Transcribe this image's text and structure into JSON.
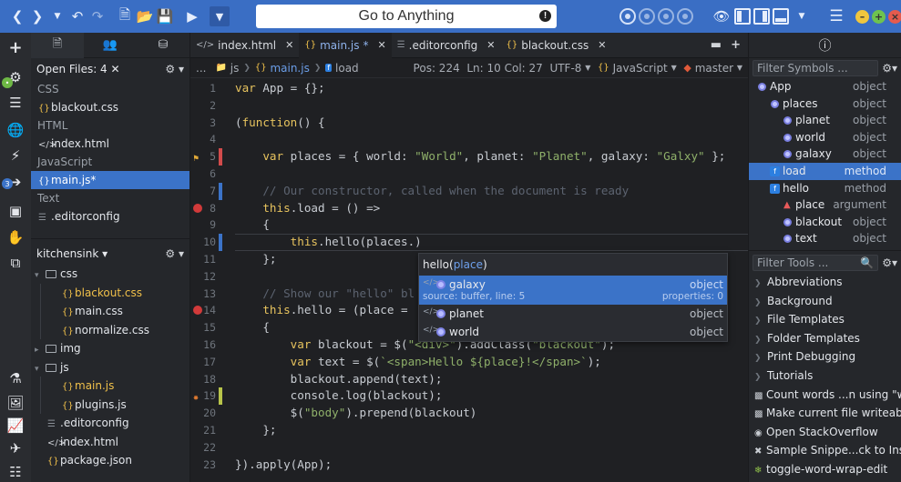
{
  "search": {
    "placeholder": "Go to Anything"
  },
  "left_panel": {
    "open_files_label": "Open Files: 4",
    "groups": [
      {
        "label": "CSS",
        "files": [
          "blackout.css"
        ]
      },
      {
        "label": "HTML",
        "files": [
          "index.html"
        ]
      },
      {
        "label": "JavaScript",
        "files": [
          "main.js*"
        ]
      },
      {
        "label": "Text",
        "files": [
          ".editorconfig"
        ]
      }
    ],
    "project_label": "kitchensink",
    "tree": {
      "css": "css",
      "css_files": [
        "blackout.css",
        "main.css",
        "normalize.css"
      ],
      "img": "img",
      "js": "js",
      "js_files": [
        "main.js",
        "plugins.js"
      ],
      "root_files": [
        ".editorconfig",
        "index.html",
        "package.json"
      ]
    }
  },
  "editor": {
    "tabs": [
      {
        "label": "index.html",
        "dirty": ""
      },
      {
        "label": "main.js",
        "dirty": "*"
      },
      {
        "label": ".editorconfig",
        "dirty": ""
      },
      {
        "label": "blackout.css",
        "dirty": ""
      }
    ],
    "breadcrumb": {
      "ellipsis": "...",
      "folder": "js",
      "file": "main.js",
      "symbol": "load"
    },
    "status": {
      "pos": "Pos: 224",
      "ln": "Ln: 10",
      "col": "Col: 27",
      "encoding": "UTF-8",
      "language": "JavaScript",
      "branch": "master"
    },
    "code_lines": [
      "var App = {};",
      "",
      "(function() {",
      "",
      "    var places = { world: \"World\", planet: \"Planet\", galaxy: \"Galxy\" };",
      "",
      "    // Our constructor, called when the document is ready",
      "    this.load = () =>",
      "    {",
      "        this.hello(places.)",
      "    };",
      "",
      "    // Show our \"hello\" bl",
      "    this.hello = (place = ",
      "    {",
      "        var blackout = $(\"<div>\").addClass(\"blackout\");",
      "        var text = $(`<span>Hello ${place}!</span>`);",
      "        blackout.append(text);",
      "        console.log(blackout);",
      "        $(\"body\").prepend(blackout)",
      "    };",
      "",
      "}).apply(App);"
    ],
    "line_numbers": [
      "1",
      "2",
      "3",
      "4",
      "5",
      "6",
      "7",
      "8",
      "9",
      "10",
      "11",
      "12",
      "13",
      "14",
      "15",
      "16",
      "17",
      "18",
      "19",
      "20",
      "21",
      "22",
      "23"
    ]
  },
  "autocomplete": {
    "signature_name": "hello(",
    "signature_arg": "place",
    "signature_close": ")",
    "items": [
      {
        "name": "galaxy",
        "type": "object",
        "source": "source: buffer, line: 5",
        "properties": "properties: 0"
      },
      {
        "name": "planet",
        "type": "object"
      },
      {
        "name": "world",
        "type": "object"
      }
    ]
  },
  "symbols": {
    "filter_placeholder": "Filter Symbols ...",
    "items": [
      {
        "name": "App",
        "type": "object"
      },
      {
        "name": "places",
        "type": "object"
      },
      {
        "name": "planet",
        "type": "object"
      },
      {
        "name": "world",
        "type": "object"
      },
      {
        "name": "galaxy",
        "type": "object"
      },
      {
        "name": "load",
        "type": "method"
      },
      {
        "name": "hello",
        "type": "method"
      },
      {
        "name": "place",
        "type": "argument"
      },
      {
        "name": "blackout",
        "type": "object"
      },
      {
        "name": "text",
        "type": "object"
      }
    ]
  },
  "tools": {
    "filter_placeholder": "Filter Tools ...",
    "folders": [
      "Abbreviations",
      "Background",
      "File Templates",
      "Folder Templates",
      "Print Debugging",
      "Tutorials"
    ],
    "commands": [
      "Count words ...n using \"wc\"",
      "Make current file writeable",
      "Open StackOverflow",
      "Sample Snippe...ck to Insert",
      "toggle-word-wrap-edit"
    ]
  },
  "colors": {
    "accent": "#3b73c8",
    "toolbar": "#3a6ec4",
    "keyword": "#e7c35e",
    "string": "#8fb06a"
  }
}
